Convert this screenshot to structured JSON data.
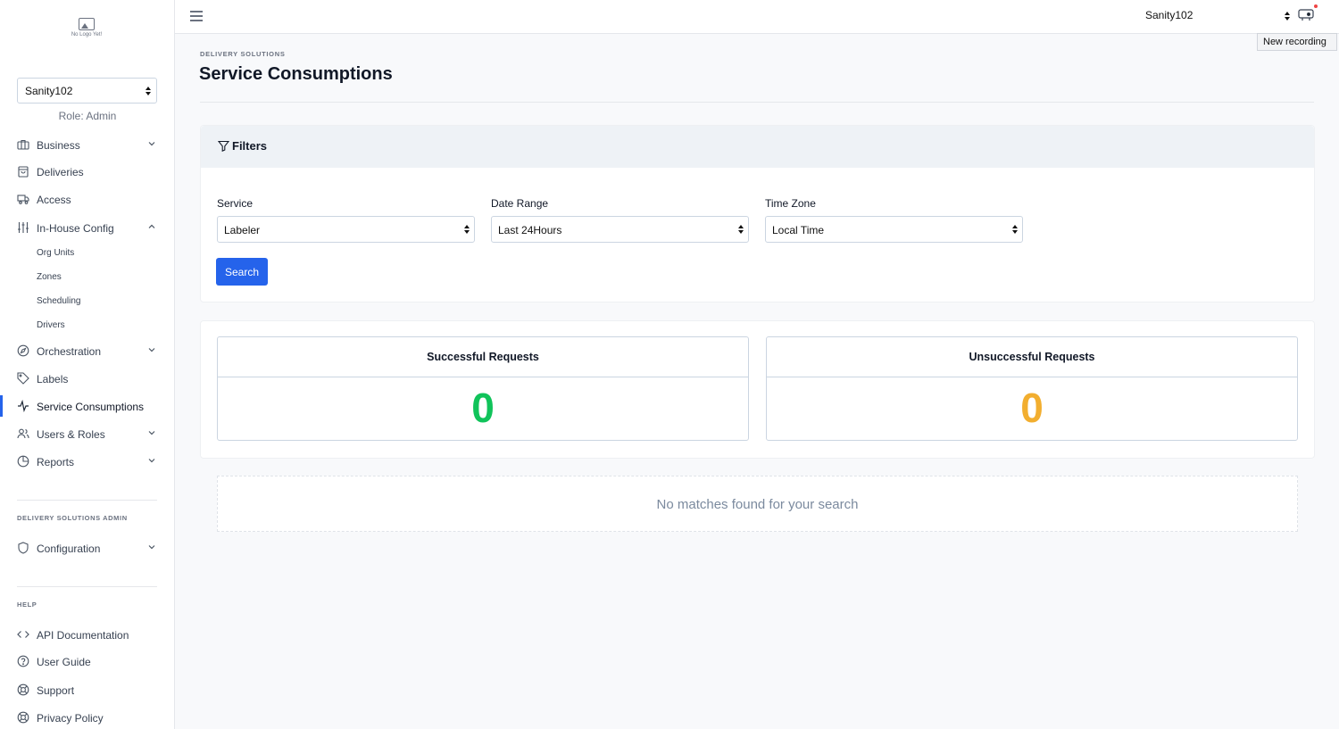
{
  "sidebar": {
    "logo_text": "No Logo Yet!",
    "org_select": "Sanity102",
    "role": "Role: Admin",
    "items": {
      "business": "Business",
      "deliveries": "Deliveries",
      "access": "Access",
      "in_house_config": "In-House Config",
      "org_units": "Org Units",
      "zones": "Zones",
      "scheduling": "Scheduling",
      "drivers": "Drivers",
      "orchestration": "Orchestration",
      "labels": "Labels",
      "service_consumptions": "Service Consumptions",
      "users_roles": "Users & Roles",
      "reports": "Reports"
    },
    "admin_section": "DELIVERY SOLUTIONS ADMIN",
    "configuration": "Configuration",
    "help_section": "HELP",
    "help": {
      "api_docs": "API Documentation",
      "user_guide": "User Guide",
      "support": "Support",
      "privacy": "Privacy Policy"
    }
  },
  "topbar": {
    "user_select": "Sanity102",
    "tooltip": "New recording"
  },
  "main": {
    "eyebrow": "DELIVERY SOLUTIONS",
    "title": "Service Consumptions",
    "filters": {
      "title": "Filters",
      "service_label": "Service",
      "service_value": "Labeler",
      "date_label": "Date Range",
      "date_value": "Last 24Hours",
      "tz_label": "Time Zone",
      "tz_value": "Local Time",
      "search": "Search"
    },
    "stats": {
      "success_label": "Successful Requests",
      "success_value": "0",
      "fail_label": "Unsuccessful Requests",
      "fail_value": "0"
    },
    "empty": "No matches found for your search"
  },
  "colors": {
    "accent": "#2563eb",
    "success": "#10c35a",
    "warning": "#f2ae2f"
  }
}
